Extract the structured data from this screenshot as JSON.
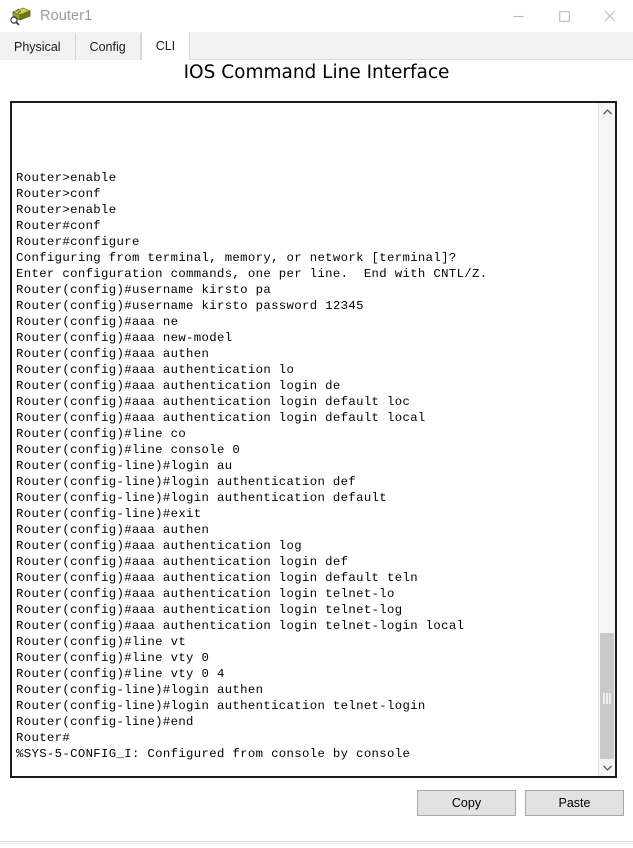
{
  "window": {
    "title": "Router1",
    "icon": "router-icon",
    "controls": [
      {
        "name": "minimize-button",
        "glyph": "minimize-icon"
      },
      {
        "name": "maximize-button",
        "glyph": "maximize-icon"
      },
      {
        "name": "close-button",
        "glyph": "close-icon"
      }
    ]
  },
  "tabs": [
    {
      "label": "Physical",
      "active": false
    },
    {
      "label": "Config",
      "active": false
    },
    {
      "label": "CLI",
      "active": true
    }
  ],
  "panel": {
    "title": "IOS Command Line Interface"
  },
  "terminal": {
    "lines": [
      "",
      "",
      "",
      "",
      "Router>enable",
      "Router>conf",
      "Router>enable",
      "Router#conf",
      "Router#configure",
      "Configuring from terminal, memory, or network [terminal]?",
      "Enter configuration commands, one per line.  End with CNTL/Z.",
      "Router(config)#username kirsto pa",
      "Router(config)#username kirsto password 12345",
      "Router(config)#aaa ne",
      "Router(config)#aaa new-model",
      "Router(config)#aaa authen",
      "Router(config)#aaa authentication lo",
      "Router(config)#aaa authentication login de",
      "Router(config)#aaa authentication login default loc",
      "Router(config)#aaa authentication login default local",
      "Router(config)#line co",
      "Router(config)#line console 0",
      "Router(config-line)#login au",
      "Router(config-line)#login authentication def",
      "Router(config-line)#login authentication default",
      "Router(config-line)#exit",
      "Router(config)#aaa authen",
      "Router(config)#aaa authentication log",
      "Router(config)#aaa authentication login def",
      "Router(config)#aaa authentication login default teln",
      "Router(config)#aaa authentication login telnet-lo",
      "Router(config)#aaa authentication login telnet-log",
      "Router(config)#aaa authentication login telnet-login local",
      "Router(config)#line vt",
      "Router(config)#line vty 0",
      "Router(config)#line vty 0 4",
      "Router(config-line)#login authen",
      "Router(config-line)#login authentication telnet-login",
      "Router(config-line)#end",
      "Router#",
      "%SYS-5-CONFIG_I: Configured from console by console"
    ]
  },
  "scrollbar": {
    "up_arrow": "chevron-up-icon",
    "down_arrow": "chevron-down-icon"
  },
  "buttons": {
    "copy_label": "Copy",
    "paste_label": "Paste"
  },
  "colors": {
    "terminal_border": "#1b1b1b",
    "tabstrip_bg": "#f2f2f2",
    "button_bg": "#e2e2e2",
    "title_text": "#9a9a9a"
  }
}
